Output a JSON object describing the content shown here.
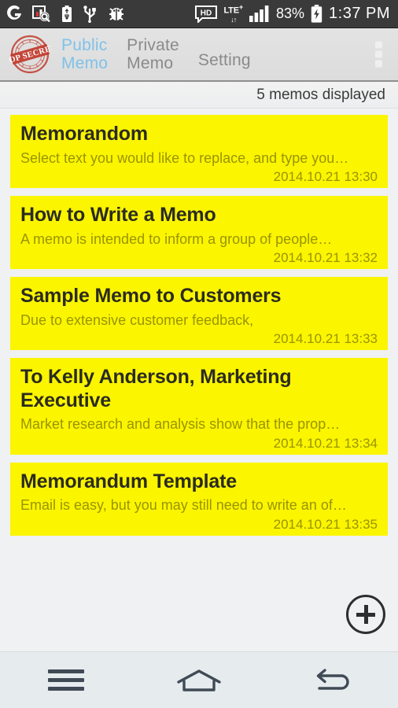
{
  "status_bar": {
    "icons": [
      {
        "name": "carrier-logo-icon",
        "glyph": "G"
      },
      {
        "name": "chart-search-icon",
        "glyph": "chart"
      },
      {
        "name": "usb-battery-icon",
        "glyph": "usb-batt"
      },
      {
        "name": "usb-icon",
        "glyph": "usb"
      },
      {
        "name": "bug-icon",
        "glyph": "bug"
      }
    ],
    "hd_label": "HD",
    "network_label": "LTE",
    "network_superscript": "+",
    "network_arrows": "↓↑",
    "battery_percent": "83%",
    "clock": "1:37 PM"
  },
  "app_bar": {
    "logo_name": "top-secret-stamp-logo",
    "logo_text": "TOP SECRET",
    "tabs": [
      {
        "label": "Public\nMemo",
        "active": true,
        "name": "tab-public-memo"
      },
      {
        "label": "Private\nMemo",
        "active": false,
        "name": "tab-private-memo"
      },
      {
        "label": "Setting",
        "active": false,
        "name": "tab-setting"
      }
    ],
    "overflow_name": "overflow-menu-icon",
    "active_color": "#7fc2e8",
    "inactive_color": "#8a8a8a"
  },
  "count_bar": {
    "text": "5 memos displayed"
  },
  "memos": [
    {
      "title": "Memorandom",
      "snippet": "Select text you would like to replace, and type you…",
      "date": "2014.10.21 13:30"
    },
    {
      "title": "How to Write a Memo",
      "snippet": "A memo is intended to inform a group of people…",
      "date": "2014.10.21 13:32"
    },
    {
      "title": "Sample Memo to Customers",
      "snippet": "Due to extensive customer feedback,",
      "date": "2014.10.21 13:33"
    },
    {
      "title": "To Kelly Anderson, Marketing Executive",
      "snippet": "Market research and analysis show that the prop…",
      "date": "2014.10.21 13:34"
    },
    {
      "title": "Memorandum Template",
      "snippet": "Email is easy, but you may still need to write an of…",
      "date": "2014.10.21 13:35"
    }
  ],
  "fab": {
    "name": "add-memo-button",
    "icon": "plus-icon"
  },
  "nav_bar": {
    "buttons": [
      {
        "name": "nav-menu-button",
        "icon": "menu-icon"
      },
      {
        "name": "nav-home-button",
        "icon": "home-icon"
      },
      {
        "name": "nav-back-button",
        "icon": "back-arrow-icon"
      }
    ]
  },
  "colors": {
    "memo_card": "#fbf500",
    "status_bar": "#3a3a3a",
    "app_bar": "#e0e0e0",
    "nav_bar": "#e6ebee"
  }
}
